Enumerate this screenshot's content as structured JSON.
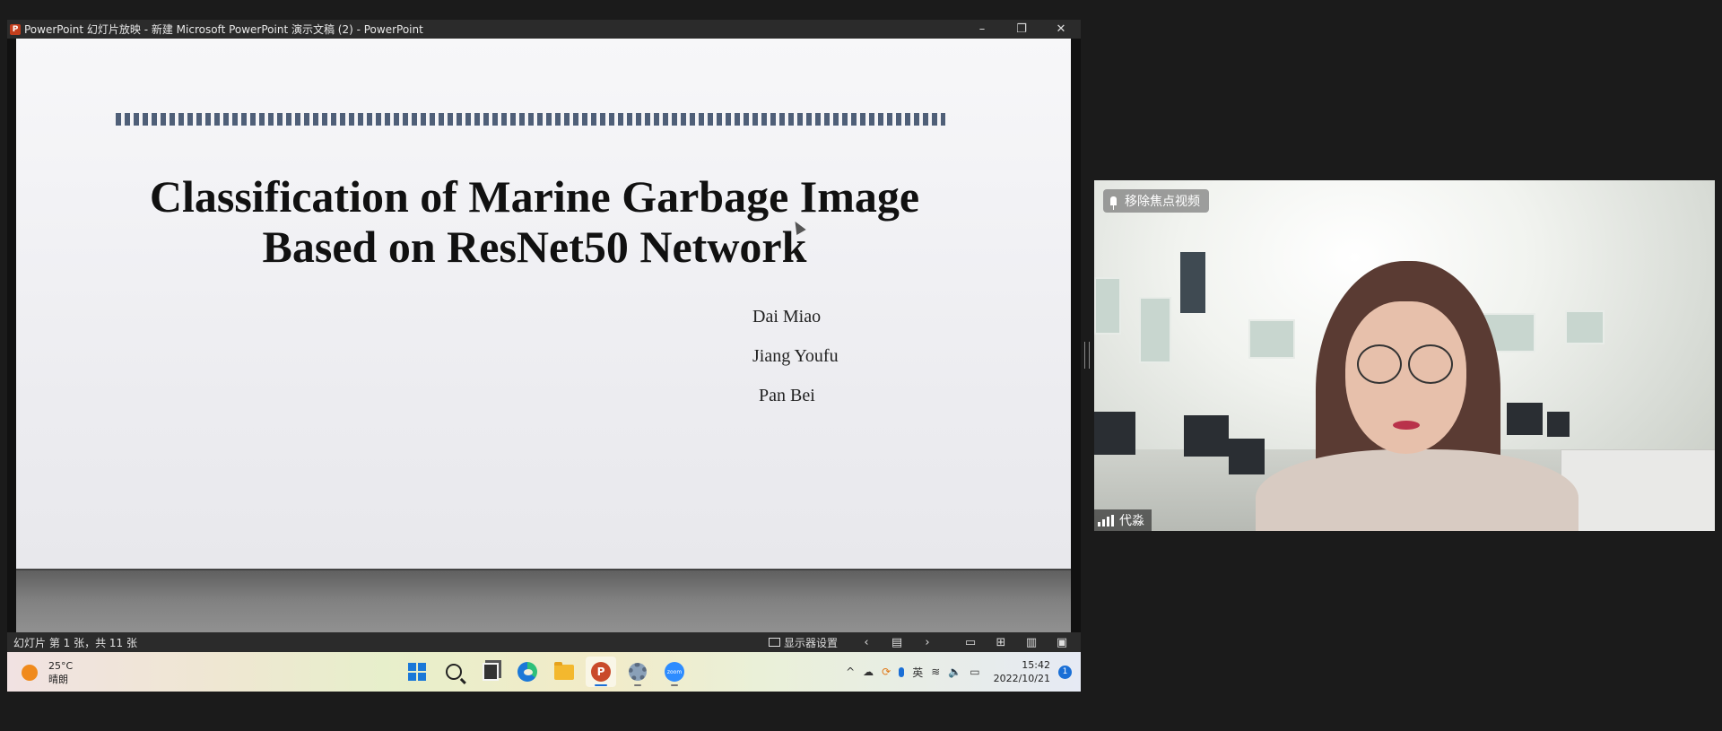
{
  "window": {
    "app_icon": "P",
    "title": "PowerPoint 幻灯片放映  -  新建 Microsoft PowerPoint 演示文稿 (2) - PowerPoint",
    "controls": {
      "minimize": "–",
      "restore": "❐",
      "close": "✕"
    }
  },
  "slide": {
    "title_line1": "Classification of Marine Garbage Image",
    "title_line2": "Based on ResNet50 Network",
    "authors": [
      "Dai Miao",
      "Jiang Youfu",
      "Pan Bei"
    ]
  },
  "statusbar": {
    "slide_count": "幻灯片 第 1 张，共 11 张",
    "display_settings": "显示器设置",
    "prev": "‹",
    "menu": "▤",
    "next": "›",
    "normal_view": "▭",
    "grid_view": "⊞",
    "reading_view": "▥",
    "presenter_view": "▣"
  },
  "taskbar": {
    "weather_temp": "25°C",
    "weather_desc": "晴朗",
    "apps": [
      {
        "name": "start-button",
        "icon": "start-icon"
      },
      {
        "name": "search-button",
        "icon": "search-icon"
      },
      {
        "name": "task-view-button",
        "icon": "task-view-icon"
      },
      {
        "name": "edge-button",
        "icon": "edge-icon"
      },
      {
        "name": "file-explorer-button",
        "icon": "folder-icon"
      },
      {
        "name": "powerpoint-button",
        "icon": "powerpoint-icon"
      },
      {
        "name": "settings-button",
        "icon": "gear-icon"
      },
      {
        "name": "zoom-button",
        "icon": "zoom-icon"
      }
    ],
    "zoom_label": "zoom",
    "ppt_label": "P",
    "tray": {
      "chevron": "^",
      "cloud": "☁",
      "sync": "⟳",
      "ime": "英",
      "wifi": "≋",
      "volume": "🔈",
      "battery": "▭"
    },
    "time": "15:42",
    "date": "2022/10/21",
    "notifications": "1"
  },
  "video": {
    "unpin_label": "移除焦点视频",
    "participant_name": "代淼"
  },
  "colors": {
    "titlebar": "#2b2b2b",
    "accent_blue": "#1a6fd6",
    "stripe": "#4f5f78"
  }
}
